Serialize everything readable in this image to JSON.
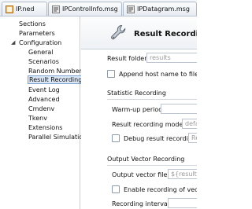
{
  "tabs": [
    {
      "label": "IP.ned"
    },
    {
      "label": "IPControlInfo.msg"
    },
    {
      "label": "IPDatagram.msg"
    }
  ],
  "tree": {
    "items": [
      {
        "label": "Sections"
      },
      {
        "label": "Parameters"
      },
      {
        "label": "Configuration"
      },
      {
        "label": "General"
      },
      {
        "label": "Scenarios"
      },
      {
        "label": "Random Numbers"
      },
      {
        "label": "Result Recording"
      },
      {
        "label": "Event Log"
      },
      {
        "label": "Advanced"
      },
      {
        "label": "Cmdenv"
      },
      {
        "label": "Tkenv"
      },
      {
        "label": "Extensions"
      },
      {
        "label": "Parallel Simulation"
      }
    ]
  },
  "page": {
    "title": "Result Recording",
    "result_folder_label": "Result folder:",
    "result_folder_placeholder": "results",
    "append_host_label": "Append host name to filename",
    "statistic_recording": {
      "heading": "Statistic Recording",
      "warmup_label": "Warm-up period:",
      "modes_label": "Result recording modes:",
      "modes_placeholder": "default",
      "debug_label": "Debug result recording",
      "debug_placeholder": "Re"
    },
    "output_vector": {
      "heading": "Output Vector Recording",
      "file_label": "Output vector file:",
      "file_placeholder": "${resultdir}",
      "enable_label": "Enable recording of vectors",
      "intervals_label": "Recording intervals:"
    }
  }
}
